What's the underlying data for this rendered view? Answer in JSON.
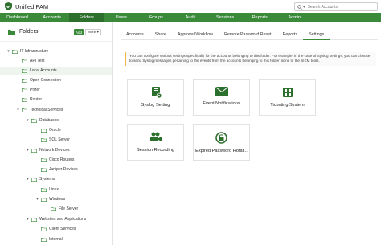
{
  "app": {
    "title": "Unified PAM"
  },
  "search": {
    "placeholder": "Search Accounts"
  },
  "nav": [
    "Dashboard",
    "Accounts",
    "Folders",
    "Users",
    "Groups",
    "Audit",
    "Sessions",
    "Reports",
    "Admin"
  ],
  "nav_active": "Folders",
  "sidebar": {
    "title": "Folders",
    "add_label": "Add",
    "more_label": "More ▾",
    "tree": [
      {
        "label": "IT Infrastructure",
        "expanded": true
      },
      {
        "label": "API Test"
      },
      {
        "label": "Local Accounts",
        "selected": true
      },
      {
        "label": "Open Connection"
      },
      {
        "label": "Pfizer"
      },
      {
        "label": "Router"
      },
      {
        "label": "Technical Services",
        "expanded": true
      },
      {
        "label": "Databases",
        "expanded": true
      },
      {
        "label": "Oracle"
      },
      {
        "label": "SQL Server"
      },
      {
        "label": "Network Devices",
        "expanded": true
      },
      {
        "label": "Cisco Routers"
      },
      {
        "label": "Juniper Devices"
      },
      {
        "label": "Systems",
        "expanded": true
      },
      {
        "label": "Linux"
      },
      {
        "label": "Windows",
        "expanded": true
      },
      {
        "label": "File Server"
      },
      {
        "label": "Websites and Applications",
        "expanded": true
      },
      {
        "label": "Client Services"
      },
      {
        "label": "Internal"
      }
    ]
  },
  "tabs": [
    "Accounts",
    "Share",
    "Approval Workflow",
    "Remote Password Reset",
    "Reports",
    "Settings"
  ],
  "active_tab": "Settings",
  "info_text": "You can configure various settings specifically for the accounts belonging to this folder. For example, in the case of Syslog settings, you can choose to send Syslog messages pertaining to the events from the accounts belonging to this folder alone to the SIEM tools.",
  "cards": [
    {
      "label": "Syslog Setting",
      "icon": "syslog-icon"
    },
    {
      "label": "Event Notifications",
      "icon": "envelope-icon"
    },
    {
      "label": "Ticketing System",
      "icon": "ticket-icon"
    },
    {
      "label": "Session Recording",
      "icon": "video-camera-icon"
    },
    {
      "label": "Expired Password Rotat...",
      "icon": "lock-rotate-icon"
    }
  ],
  "colors": {
    "brand": "#3a8a3a",
    "brand_dark": "#2d6f2d",
    "accent_warning": "#f2b84b"
  }
}
